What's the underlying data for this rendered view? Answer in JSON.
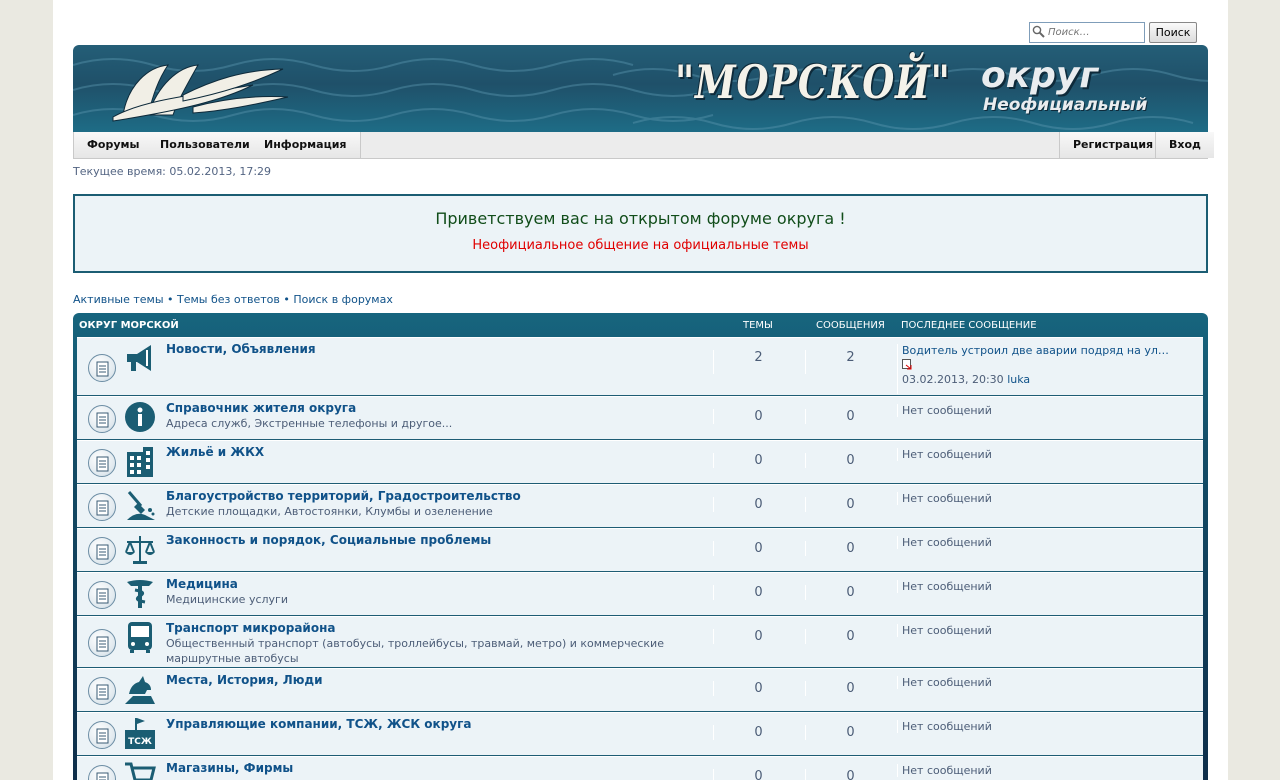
{
  "search": {
    "placeholder": "Поиск…",
    "button_label": "Поиск"
  },
  "banner": {
    "title": "\"МОРСКОЙ\"",
    "okrug": "округ",
    "subtitle": "Неофициальный"
  },
  "navbar": {
    "left": [
      "Форумы",
      "Пользователи",
      "Информация"
    ],
    "right": [
      "Регистрация",
      "Вход"
    ]
  },
  "current_time": "Текущее время: 05.02.2013, 17:29",
  "welcome": {
    "title": "Приветствуем вас на открытом форуме округа !",
    "subtitle": "Неофициальное общение на официальные темы"
  },
  "quick_links": [
    "Активные темы",
    "Темы без ответов",
    "Поиск в форумах"
  ],
  "quick_links_sep": " • ",
  "table": {
    "headers": {
      "category": "Округ Морской",
      "topics": "Темы",
      "posts": "Сообщения",
      "last_post": "Последнее сообщение"
    },
    "rows": [
      {
        "icon": "megaphone-icon",
        "title": "Новости, Объявления",
        "desc": "",
        "topics": "2",
        "posts": "2",
        "last_title": "Водитель устроил две аварии подряд на ул…",
        "last_date": "03.02.2013, 20:30",
        "last_author": "luka"
      },
      {
        "icon": "info-icon",
        "title": "Справочник жителя округа",
        "desc": "Адреса служб, Экстренные телефоны и другое...",
        "topics": "0",
        "posts": "0",
        "last": "Нет сообщений"
      },
      {
        "icon": "building-icon",
        "title": "Жильё и ЖКХ",
        "desc": "",
        "topics": "0",
        "posts": "0",
        "last": "Нет сообщений"
      },
      {
        "icon": "shovel-icon",
        "title": "Благоустройство территорий, Градостроительство",
        "desc": "Детские площадки, Автостоянки, Клумбы и озеленение",
        "topics": "0",
        "posts": "0",
        "last": "Нет сообщений"
      },
      {
        "icon": "scales-icon",
        "title": "Законность и порядок, Социальные проблемы",
        "desc": "",
        "topics": "0",
        "posts": "0",
        "last": "Нет сообщений"
      },
      {
        "icon": "caduceus-icon",
        "title": "Медицина",
        "desc": "Медицинские услуги",
        "topics": "0",
        "posts": "0",
        "last": "Нет сообщений"
      },
      {
        "icon": "bus-icon",
        "title": "Транспорт микрорайона",
        "desc": "Общественный транспорт (автобусы, троллейбусы, травмай, метро) и коммерческие маршрутные автобусы",
        "topics": "0",
        "posts": "0",
        "last": "Нет сообщений"
      },
      {
        "icon": "monument-icon",
        "title": "Места, История, Люди",
        "desc": "",
        "topics": "0",
        "posts": "0",
        "last": "Нет сообщений"
      },
      {
        "icon": "tsj-icon",
        "icon_text": "ТСЖ",
        "title": "Управляющие компании, ТСЖ, ЖСК округа",
        "desc": "",
        "topics": "0",
        "posts": "0",
        "last": "Нет сообщений"
      },
      {
        "icon": "cart-icon",
        "title": "Магазины, Фирмы",
        "desc": "",
        "topics": "0",
        "posts": "0",
        "last": "Нет сообщений"
      }
    ]
  }
}
